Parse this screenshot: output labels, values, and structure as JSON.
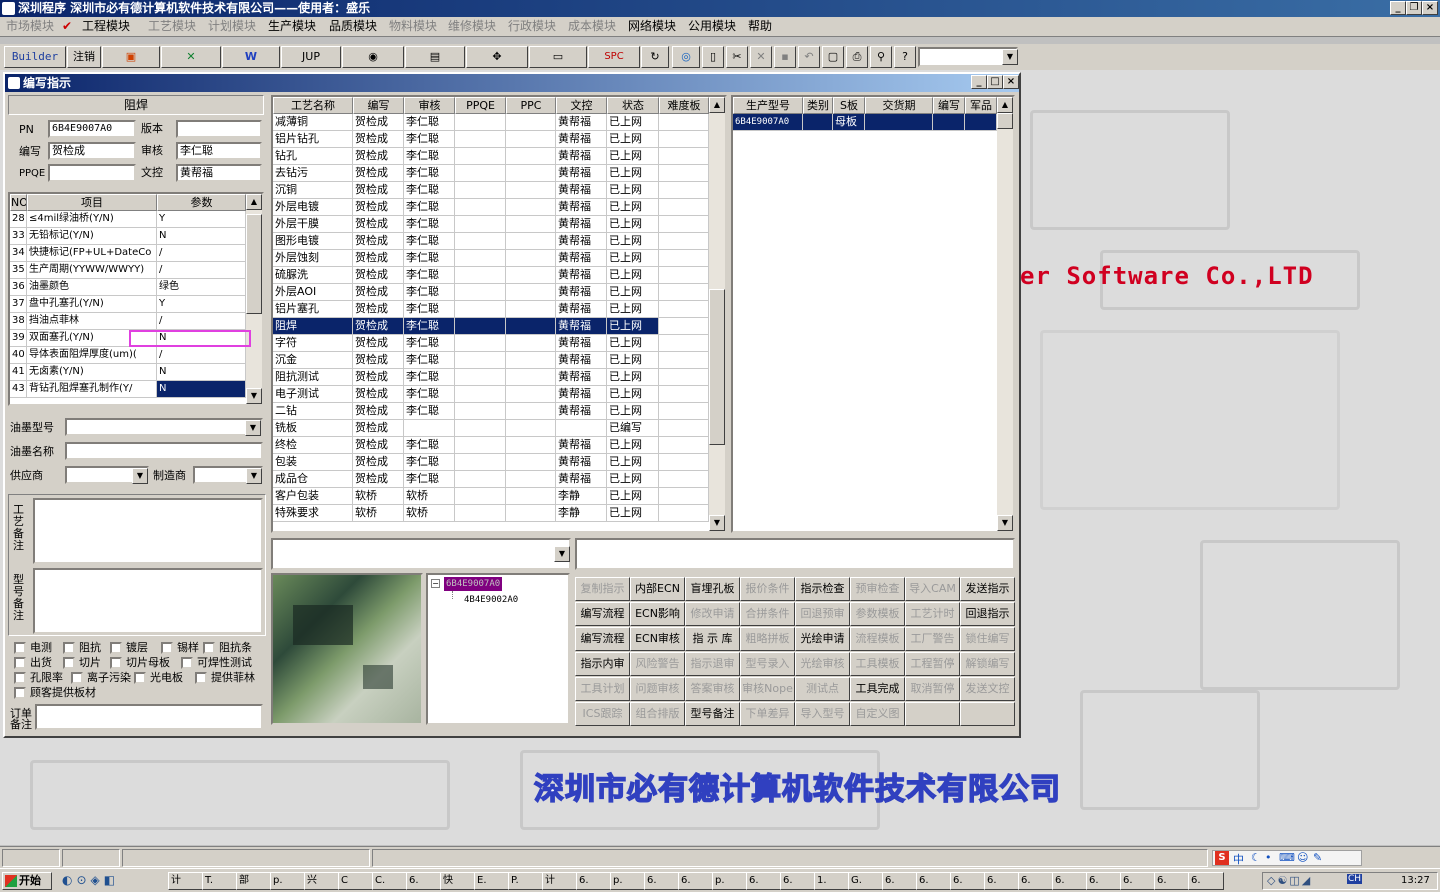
{
  "app": {
    "title": "深圳程序    深圳市必有德计算机软件技术有限公司——使用者：盛乐",
    "menu": [
      "市场模块",
      "工程模块",
      "工艺模块",
      "计划模块",
      "生产模块",
      "品质模块",
      "物料模块",
      "维修模块",
      "行政模块",
      "成本模块",
      "网络模块",
      "公用模块",
      "帮助"
    ]
  },
  "toolbar": {
    "builder": "Builder",
    "logout": "注销",
    "jup": "JUP",
    "spc": "SPC"
  },
  "window": {
    "title": "编写指示",
    "section_label": "阻焊",
    "form": {
      "pn_label": "PN",
      "pn_value": "6B4E9007A0",
      "version_label": "版本",
      "version_value": "",
      "writer_label": "编写",
      "writer_value": "贺检成",
      "reviewer_label": "审核",
      "reviewer_value": "李仁聪",
      "ppqe_label": "PPQE",
      "ppqe_value": "",
      "doc_label": "文控",
      "doc_value": "黄帮福"
    },
    "param_table": {
      "headers": [
        "NO",
        "项目",
        "参数"
      ],
      "rows": [
        {
          "no": "28",
          "item": "≤4mil绿油桥(Y/N)",
          "val": "Y"
        },
        {
          "no": "33",
          "item": "无铅标记(Y/N)",
          "val": "N"
        },
        {
          "no": "34",
          "item": "快捷标记(FP+UL+DateCo",
          "val": "/"
        },
        {
          "no": "35",
          "item": "生产周期(YYWW/WWYY)",
          "val": "/"
        },
        {
          "no": "36",
          "item": "油墨颜色",
          "val": "绿色"
        },
        {
          "no": "37",
          "item": "盘中孔塞孔(Y/N)",
          "val": "Y"
        },
        {
          "no": "38",
          "item": "挡油点菲林",
          "val": "/"
        },
        {
          "no": "39",
          "item": "双面塞孔(Y/N)",
          "val": "N"
        },
        {
          "no": "40",
          "item": "导体表面阻焊厚度(um)(",
          "val": "/"
        },
        {
          "no": "41",
          "item": "无卤素(Y/N)",
          "val": "N"
        },
        {
          "no": "43",
          "item": "背钻孔阻焊塞孔制作(Y/",
          "val": "N"
        }
      ]
    },
    "ink": {
      "model_label": "油墨型号",
      "name_label": "油墨名称",
      "supplier_label": "供应商",
      "maker_label": "制造商"
    },
    "remarks": {
      "process_label": "工艺备注",
      "model_label": "型号备注",
      "order_label": "订单备注"
    },
    "checkboxes": [
      "电测",
      "阻抗",
      "镀层",
      "锡样",
      "阻抗条",
      "出货",
      "切片",
      "切片母板",
      "可焊性测试",
      "孔限率",
      "离子污染",
      "光电板",
      "提供菲林",
      "顾客提供板材"
    ],
    "process_table": {
      "headers": [
        "工艺名称",
        "编写",
        "审核",
        "PPQE",
        "PPC",
        "文控",
        "状态",
        "难度板"
      ],
      "rows": [
        [
          "减薄铜",
          "贺检成",
          "李仁聪",
          "",
          "",
          "黄帮福",
          "已上网"
        ],
        [
          "铝片钻孔",
          "贺检成",
          "李仁聪",
          "",
          "",
          "黄帮福",
          "已上网"
        ],
        [
          "钻孔",
          "贺检成",
          "李仁聪",
          "",
          "",
          "黄帮福",
          "已上网"
        ],
        [
          "去钻污",
          "贺检成",
          "李仁聪",
          "",
          "",
          "黄帮福",
          "已上网"
        ],
        [
          "沉铜",
          "贺检成",
          "李仁聪",
          "",
          "",
          "黄帮福",
          "已上网"
        ],
        [
          "外层电镀",
          "贺检成",
          "李仁聪",
          "",
          "",
          "黄帮福",
          "已上网"
        ],
        [
          "外层干膜",
          "贺检成",
          "李仁聪",
          "",
          "",
          "黄帮福",
          "已上网"
        ],
        [
          "图形电镀",
          "贺检成",
          "李仁聪",
          "",
          "",
          "黄帮福",
          "已上网"
        ],
        [
          "外层蚀刻",
          "贺检成",
          "李仁聪",
          "",
          "",
          "黄帮福",
          "已上网"
        ],
        [
          "硫脲洗",
          "贺检成",
          "李仁聪",
          "",
          "",
          "黄帮福",
          "已上网"
        ],
        [
          "外层AOI",
          "贺检成",
          "李仁聪",
          "",
          "",
          "黄帮福",
          "已上网"
        ],
        [
          "铝片塞孔",
          "贺检成",
          "李仁聪",
          "",
          "",
          "黄帮福",
          "已上网"
        ],
        [
          "阻焊",
          "贺检成",
          "李仁聪",
          "",
          "",
          "黄帮福",
          "已上网"
        ],
        [
          "字符",
          "贺检成",
          "李仁聪",
          "",
          "",
          "黄帮福",
          "已上网"
        ],
        [
          "沉金",
          "贺检成",
          "李仁聪",
          "",
          "",
          "黄帮福",
          "已上网"
        ],
        [
          "阻抗测试",
          "贺检成",
          "李仁聪",
          "",
          "",
          "黄帮福",
          "已上网"
        ],
        [
          "电子测试",
          "贺检成",
          "李仁聪",
          "",
          "",
          "黄帮福",
          "已上网"
        ],
        [
          "二钻",
          "贺检成",
          "李仁聪",
          "",
          "",
          "黄帮福",
          "已上网"
        ],
        [
          "铣板",
          "贺检成",
          "",
          "",
          "",
          "",
          "已编写"
        ],
        [
          "终检",
          "贺检成",
          "李仁聪",
          "",
          "",
          "黄帮福",
          "已上网"
        ],
        [
          "包装",
          "贺检成",
          "李仁聪",
          "",
          "",
          "黄帮福",
          "已上网"
        ],
        [
          "成品仓",
          "贺检成",
          "李仁聪",
          "",
          "",
          "黄帮福",
          "已上网"
        ],
        [
          "客户包装",
          "软桥",
          "软桥",
          "",
          "",
          "李静",
          "已上网"
        ],
        [
          "特殊要求",
          "软桥",
          "软桥",
          "",
          "",
          "李静",
          "已上网"
        ]
      ]
    },
    "model_table": {
      "headers": [
        "生产型号",
        "类别",
        "S板",
        "交货期",
        "编写",
        "军品"
      ],
      "rows": [
        [
          "6B4E9007A0",
          "",
          "母板",
          "",
          "",
          ""
        ]
      ]
    },
    "tree": {
      "root": "6B4E9007A0",
      "child": "4B4E9002A0"
    },
    "buttons": [
      [
        "复制指示",
        "内部ECN",
        "盲埋孔板",
        "报价条件",
        "指示检查",
        "预审检查",
        "导入CAM",
        "发送指示"
      ],
      [
        "编写流程",
        "ECN影响",
        "修改申请",
        "合拼条件",
        "回退预审",
        "参数模板",
        "工艺计时",
        "回退指示"
      ],
      [
        "编写流程",
        "ECN审核",
        "指 示 库",
        "粗略拼板",
        "光绘申请",
        "流程模板",
        "工厂警告",
        "锁住编写"
      ],
      [
        "指示内审",
        "风险警告",
        "指示退审",
        "型号录入",
        "光绘审核",
        "工具模板",
        "工程暂停",
        "解锁编写"
      ],
      [
        "工具计划",
        "问题审核",
        "答案审核",
        "审核Nope",
        "测试点",
        "工具完成",
        "取消暂停",
        "发送文控"
      ],
      [
        "ICS跟踪",
        "组合排版",
        "型号备注",
        "下单差异",
        "导入型号",
        "自定义图",
        "",
        ""
      ]
    ],
    "disabled_buttons": [
      "复制指示",
      "报价条件",
      "预审检查",
      "导入CAM",
      "修改申请",
      "合拼条件",
      "回退预审",
      "参数模板",
      "工艺计时",
      "粗略拼板",
      "流程模板",
      "工厂警告",
      "锁住编写",
      "风险警告",
      "指示退审",
      "型号录入",
      "光绘审核",
      "工具模板",
      "工程暂停",
      "解锁编写",
      "工具计划",
      "问题审核",
      "答案审核",
      "审核Nope",
      "测试点",
      "取消暂停",
      "发送文控",
      "ICS跟踪",
      "组合排版",
      "下单差异",
      "导入型号",
      "自定义图"
    ]
  },
  "background": {
    "english": "er Software Co.,LTD",
    "chinese": "深圳市必有德计算机软件技术有限公司"
  },
  "taskbar": {
    "start": "开始",
    "clock": "13:27",
    "tasks": [
      "计",
      "T.",
      "部",
      "p.",
      "兴",
      "C",
      "C.",
      "6.",
      "快",
      "E.",
      "P.",
      "计",
      "6.",
      "p.",
      "6.",
      "6.",
      "p.",
      "6.",
      "6.",
      "1.",
      "G.",
      "6.",
      "6.",
      "6.",
      "6.",
      "6.",
      "6.",
      "6.",
      "6.",
      "6.",
      "6."
    ],
    "ime": [
      "S",
      "中"
    ]
  },
  "colors": {
    "accent": "#0a246a",
    "highlight_box": "#e040e0",
    "brand_red": "#d00020",
    "brand_blue": "#3040c0"
  }
}
